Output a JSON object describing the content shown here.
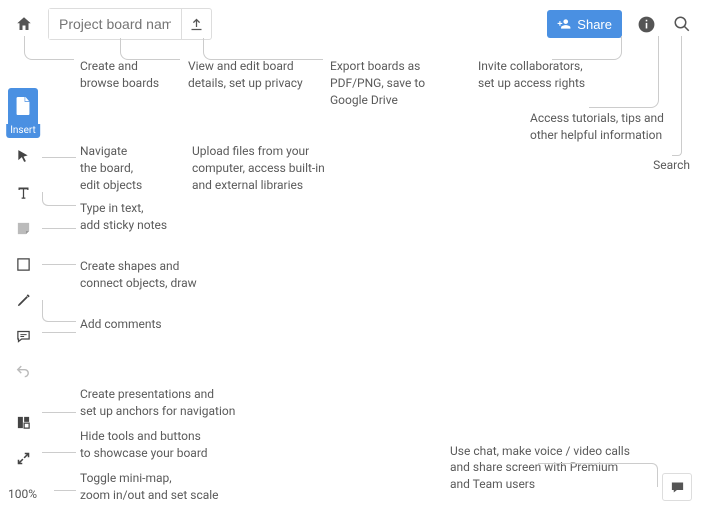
{
  "topbar": {
    "board_name_placeholder": "Project board name",
    "share_label": "Share"
  },
  "toolbar": {
    "insert_label": "Insert",
    "zoom": "100%"
  },
  "annotations": {
    "home": "Create and\nbrowse boards",
    "board_name": "View and edit board\ndetails, set up privacy",
    "export": "Export boards as\nPDF/PNG, save to\nGoogle Drive",
    "share": "Invite collaborators,\nset up access rights",
    "info": "Access tutorials, tips and\nother helpful information",
    "search": "Search",
    "insert": "Upload files from your\ncomputer, access built-in\nand external libraries",
    "select": "Navigate\nthe board,\nedit objects",
    "text": "Type in text,\nadd sticky notes",
    "shapes": "Create shapes and\nconnect objects, draw",
    "comments": "Add comments",
    "frames": "Create presentations and\nset up anchors for navigation",
    "present": "Hide tools and buttons\nto showcase your board",
    "zoom": "Toggle mini-map,\nzoom in/out and set scale",
    "chat": "Use chat, make voice / video calls\nand share screen with Premium\nand Team users"
  }
}
